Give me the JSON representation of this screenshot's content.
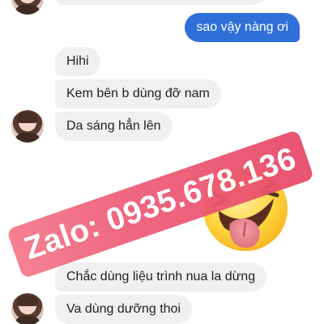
{
  "messages": {
    "outgoing": [
      "sao vậy nàng ơi"
    ],
    "incoming_group_1": [
      "Hihi",
      "Kem bên b dùng đỡ nam",
      "Da sáng hẳn lên"
    ],
    "incoming_group_2": [
      "Chắc dùng liệu trình nua la dừng",
      "Va dùng dưỡng thoi"
    ]
  },
  "watermark": {
    "text": "Zalo: 0935.678.136",
    "color": "#ef5e78"
  },
  "colors": {
    "outgoing_bubble": "#2f6fd8",
    "incoming_bubble": "#f1f0f0"
  },
  "icons": [
    "tongue-out-emoji-icon"
  ]
}
